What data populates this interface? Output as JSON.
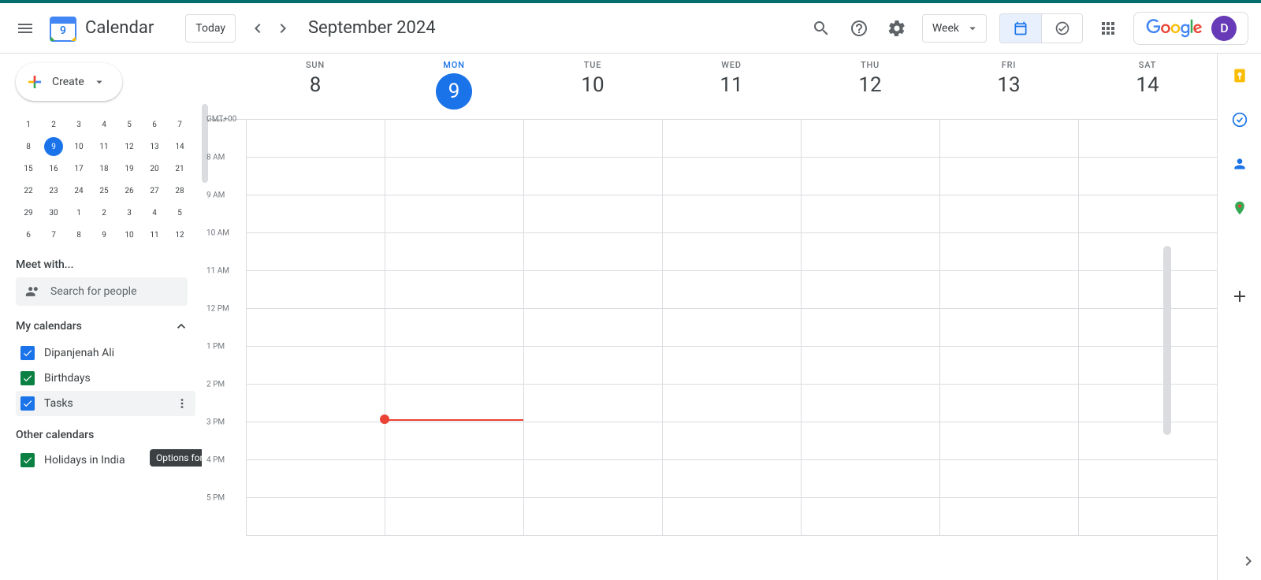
{
  "header": {
    "app_name": "Calendar",
    "today_label": "Today",
    "month_label": "September 2024",
    "view_label": "Week",
    "avatar_letter": "D",
    "logo_day": "9"
  },
  "sidebar": {
    "create_label": "Create",
    "meet_with_label": "Meet with...",
    "search_placeholder": "Search for people",
    "my_calendars_label": "My calendars",
    "other_calendars_label": "Other calendars",
    "calendars": [
      {
        "label": "Dipanjenah Ali",
        "color": "#1a73e8"
      },
      {
        "label": "Birthdays",
        "color": "#0b8043"
      },
      {
        "label": "Tasks",
        "color": "#1a73e8"
      }
    ],
    "other_calendars": [
      {
        "label": "Holidays in India",
        "color": "#0b8043"
      }
    ],
    "tooltip_text": "Options for Tasks",
    "minical": [
      [
        "1",
        "2",
        "3",
        "4",
        "5",
        "6",
        "7"
      ],
      [
        "8",
        "9",
        "10",
        "11",
        "12",
        "13",
        "14"
      ],
      [
        "15",
        "16",
        "17",
        "18",
        "19",
        "20",
        "21"
      ],
      [
        "22",
        "23",
        "24",
        "25",
        "26",
        "27",
        "28"
      ],
      [
        "29",
        "30",
        "1",
        "2",
        "3",
        "4",
        "5"
      ],
      [
        "6",
        "7",
        "8",
        "9",
        "10",
        "11",
        "12"
      ]
    ],
    "minical_today": "9"
  },
  "grid": {
    "tz_label": "GMT+00",
    "days": [
      {
        "name": "SUN",
        "num": "8",
        "today": false
      },
      {
        "name": "MON",
        "num": "9",
        "today": true
      },
      {
        "name": "TUE",
        "num": "10",
        "today": false
      },
      {
        "name": "WED",
        "num": "11",
        "today": false
      },
      {
        "name": "THU",
        "num": "12",
        "today": false
      },
      {
        "name": "FRI",
        "num": "13",
        "today": false
      },
      {
        "name": "SAT",
        "num": "14",
        "today": false
      }
    ],
    "hours": [
      "7 AM",
      "8 AM",
      "9 AM",
      "10 AM",
      "11 AM",
      "12 PM",
      "1 PM",
      "2 PM",
      "3 PM",
      "4 PM",
      "5 PM"
    ],
    "now_hour_index": 8,
    "now_day_index": 1
  }
}
